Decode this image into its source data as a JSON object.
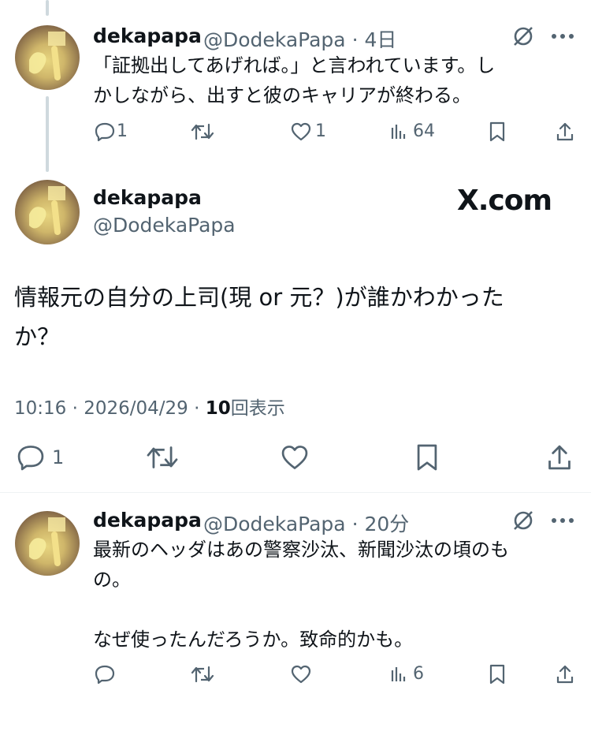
{
  "reply_top": {
    "author_name": "dekapapa",
    "handle": "@DodekaPapa",
    "time": "4日",
    "text_line1": "「証拠出してあげれば。」と言われています。し",
    "text_line2": "かしながら、出すと彼のキャリアが終わる。",
    "replies": "1",
    "likes": "1",
    "views": "64"
  },
  "main_tweet": {
    "author_name": "dekapapa",
    "handle": "@DodekaPapa",
    "source_badge": "X.com",
    "text_line1": "情報元の自分の上司(現 or 元？)が誰かわかった",
    "text_line2": "か？",
    "time": "10:16",
    "date": "2026/04/29",
    "views_count": "10",
    "views_label": "回表示",
    "replies": "1"
  },
  "reply_bottom": {
    "author_name": "dekapapa",
    "handle": "@DodekaPapa",
    "time": "20分",
    "text_line1": "最新のヘッダはあの警察沙汰、新聞沙汰の頃のも",
    "text_line2": "の。",
    "text_line3": "なぜ使ったんだろうか。致命的かも。",
    "views": "6"
  },
  "icons": [
    "grok-icon",
    "more-icon",
    "reply-icon",
    "retweet-icon",
    "like-icon",
    "views-icon",
    "bookmark-icon",
    "share-icon"
  ],
  "colors": {
    "text": "#0f1419",
    "secondary": "#536471",
    "line": "#cfd9de"
  }
}
